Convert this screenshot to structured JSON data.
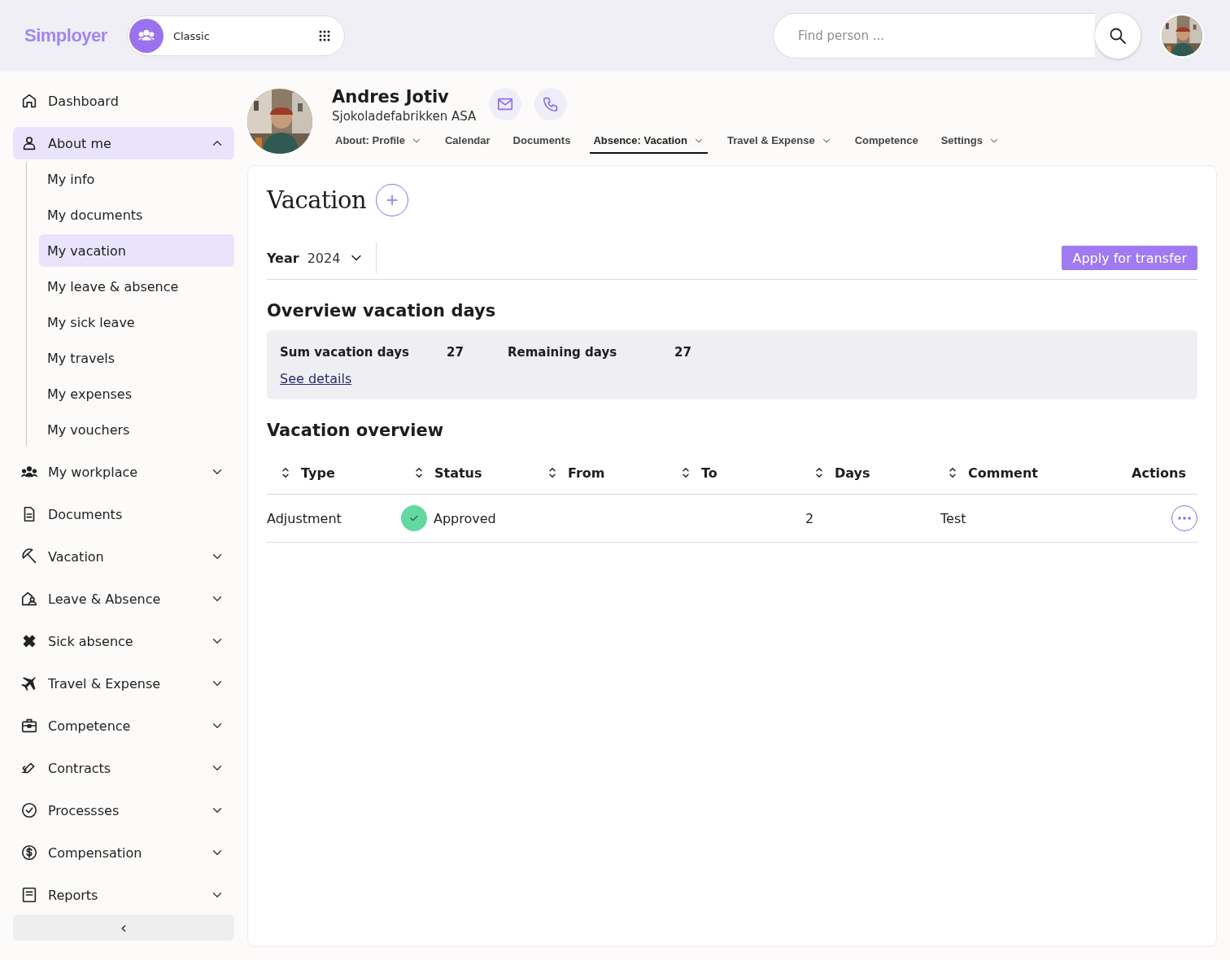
{
  "topbar": {
    "logo": "Simployer",
    "switcher": {
      "label": "Classic"
    },
    "search": {
      "placeholder": "Find person ..."
    }
  },
  "sidebar": {
    "items": [
      {
        "kind": "link",
        "label": "Dashboard",
        "selected": false
      },
      {
        "kind": "group",
        "label": "About me",
        "expanded": true,
        "selected": true,
        "children": [
          {
            "label": "My info",
            "selected": false
          },
          {
            "label": "My documents",
            "selected": false
          },
          {
            "label": "My vacation",
            "selected": true
          },
          {
            "label": "My leave & absence",
            "selected": false
          },
          {
            "label": "My sick leave",
            "selected": false
          },
          {
            "label": "My travels",
            "selected": false
          },
          {
            "label": "My expenses",
            "selected": false
          },
          {
            "label": "My vouchers",
            "selected": false
          }
        ]
      },
      {
        "kind": "group",
        "label": "My workplace",
        "expanded": false,
        "selected": false
      },
      {
        "kind": "link",
        "label": "Documents",
        "selected": false
      },
      {
        "kind": "group",
        "label": "Vacation",
        "expanded": false,
        "selected": false
      },
      {
        "kind": "group",
        "label": "Leave & Absence",
        "expanded": false,
        "selected": false
      },
      {
        "kind": "group",
        "label": "Sick absence",
        "expanded": false,
        "selected": false
      },
      {
        "kind": "group",
        "label": "Travel & Expense",
        "expanded": false,
        "selected": false
      },
      {
        "kind": "group",
        "label": "Competence",
        "expanded": false,
        "selected": false
      },
      {
        "kind": "group",
        "label": "Contracts",
        "expanded": false,
        "selected": false
      },
      {
        "kind": "group",
        "label": "Processses",
        "expanded": false,
        "selected": false
      },
      {
        "kind": "group",
        "label": "Compensation",
        "expanded": false,
        "selected": false
      },
      {
        "kind": "group",
        "label": "Reports",
        "expanded": false,
        "selected": false
      }
    ],
    "collapse_button": "‹"
  },
  "profile": {
    "name": "Andres Jotiv",
    "company": "Sjokoladefabrikken ASA",
    "tabs": [
      {
        "label": "About: Profile",
        "dropdown": true,
        "selected": false
      },
      {
        "label": "Calendar",
        "dropdown": false,
        "selected": false
      },
      {
        "label": "Documents",
        "dropdown": false,
        "selected": false
      },
      {
        "label": "Absence: Vacation",
        "dropdown": true,
        "selected": true
      },
      {
        "label": "Travel & Expense",
        "dropdown": true,
        "selected": false
      },
      {
        "label": "Competence",
        "dropdown": false,
        "selected": false
      },
      {
        "label": "Settings",
        "dropdown": true,
        "selected": false
      }
    ]
  },
  "page": {
    "title": "Vacation",
    "year_label": "Year",
    "year": "2024",
    "transfer_button": "Apply for transfer",
    "overview_title": "Overview vacation days",
    "summary": [
      {
        "label": "Sum vacation days",
        "value": "27"
      },
      {
        "label": "Remaining days",
        "value": "27"
      }
    ],
    "details_link": "See details",
    "table_title": "Vacation overview",
    "table": {
      "columns": [
        {
          "label": "Type",
          "sortable": true
        },
        {
          "label": "Status",
          "sortable": true
        },
        {
          "label": "From",
          "sortable": true
        },
        {
          "label": "To",
          "sortable": true
        },
        {
          "label": "Days",
          "sortable": true
        },
        {
          "label": "Comment",
          "sortable": true
        },
        {
          "label": "Actions",
          "sortable": false
        }
      ],
      "rows": [
        {
          "type": "Adjustment",
          "status": "Approved",
          "approved": true,
          "days": "2",
          "comment": "Test"
        }
      ]
    }
  }
}
